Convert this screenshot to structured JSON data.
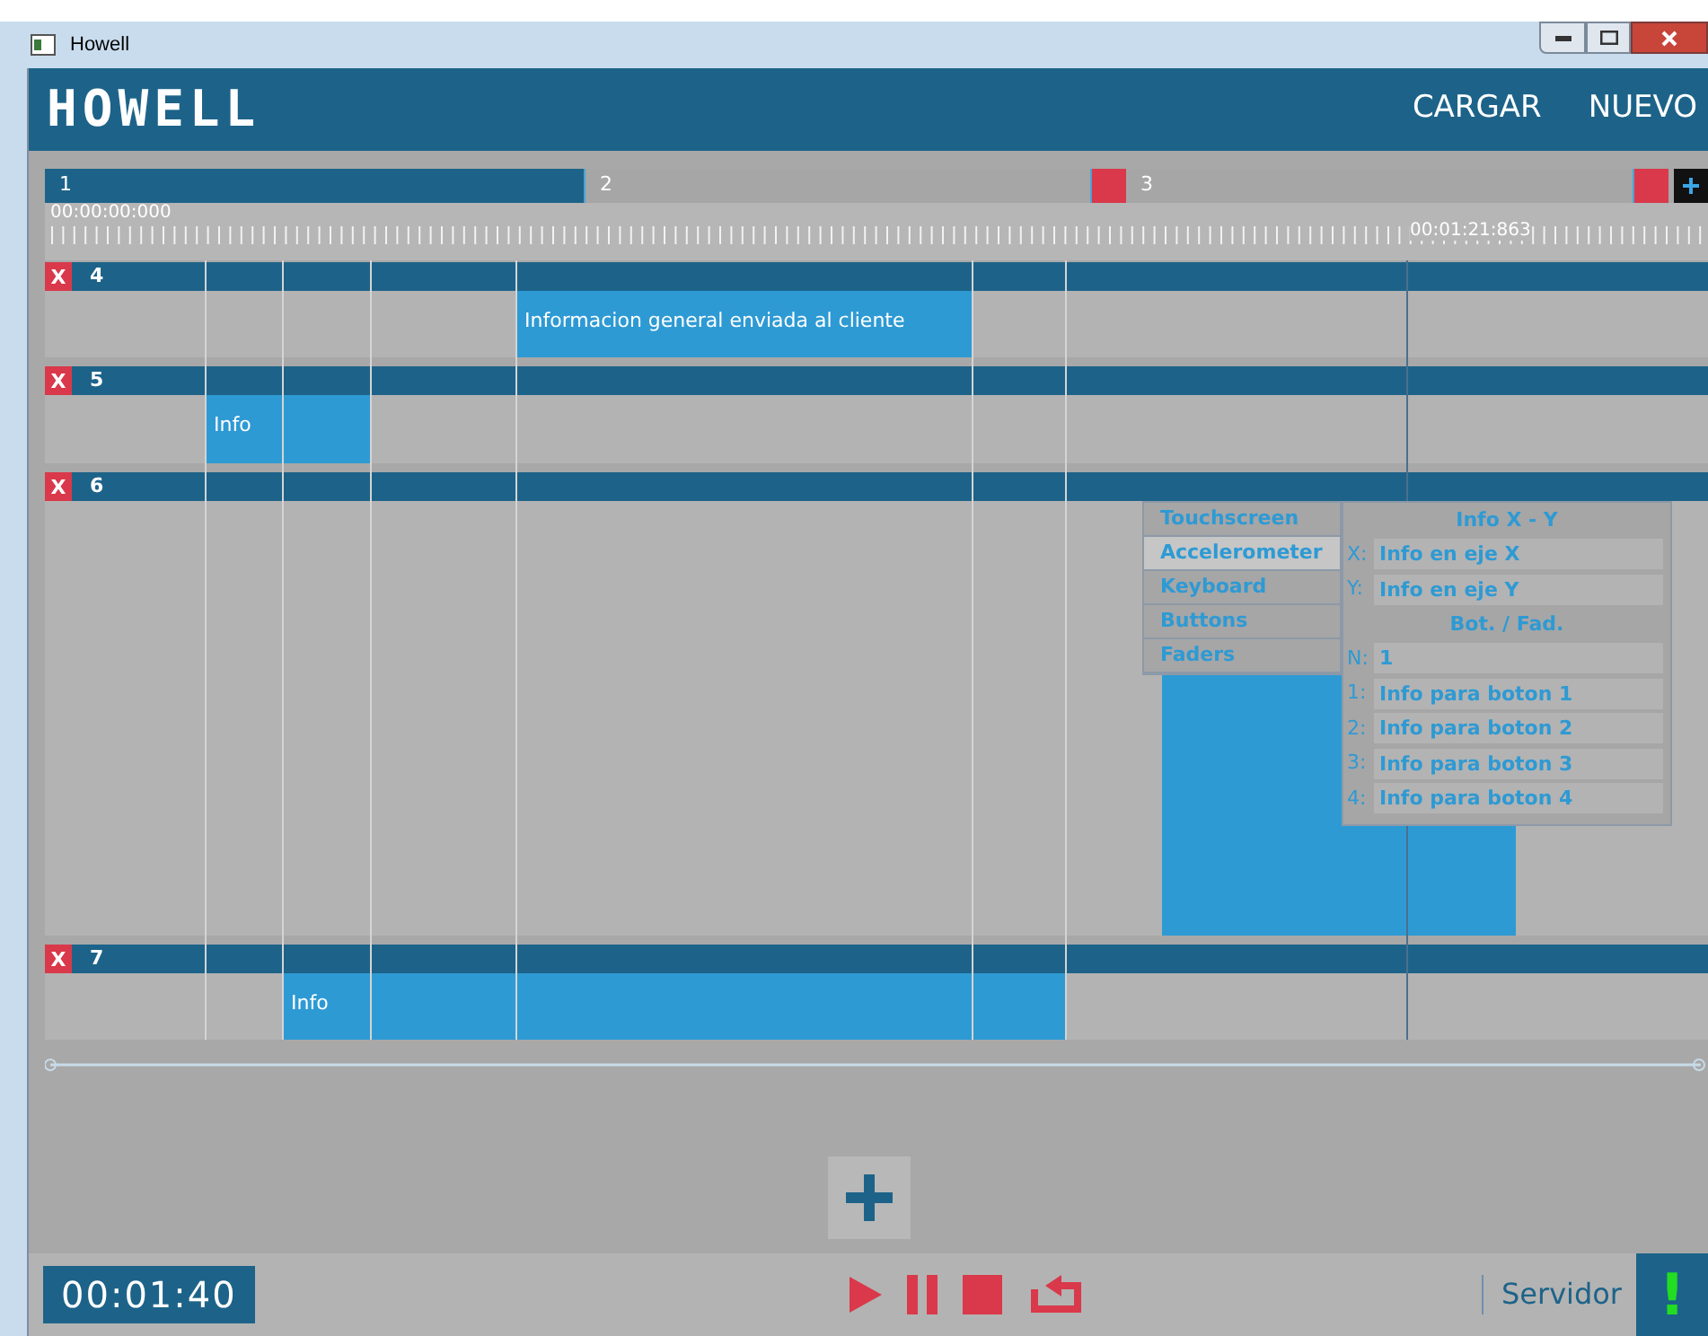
{
  "window": {
    "title": "Howell"
  },
  "header": {
    "logo": "HOWELL",
    "actions": [
      "CARGAR",
      "NUEVO"
    ]
  },
  "scenes": [
    {
      "label": "1",
      "selected": true
    },
    {
      "label": "2",
      "selected": false
    },
    {
      "label": "3",
      "selected": false
    }
  ],
  "ruler": {
    "start": "00:00:00:000",
    "playhead": "00:01:21:863"
  },
  "tracks": [
    {
      "delete": "X",
      "number": "4",
      "clips": [
        {
          "kind": "labeled",
          "text": "Informacion general enviada al cliente"
        }
      ]
    },
    {
      "delete": "X",
      "number": "5",
      "clips": [
        {
          "kind": "labeled",
          "text": "Info"
        }
      ]
    },
    {
      "delete": "X",
      "number": "6",
      "clips": [
        {
          "kind": "plain"
        }
      ]
    },
    {
      "delete": "X",
      "number": "7",
      "clips": [
        {
          "kind": "labeled",
          "text": "Info"
        }
      ]
    }
  ],
  "sensor_popup": {
    "menu": [
      {
        "label": "Touchscreen",
        "selected": false
      },
      {
        "label": "Accelerometer",
        "selected": true
      },
      {
        "label": "Keyboard",
        "selected": false
      },
      {
        "label": "Buttons",
        "selected": false
      },
      {
        "label": "Faders",
        "selected": false
      }
    ],
    "sections": [
      {
        "title": "Info X - Y",
        "fields": [
          {
            "label": "X:",
            "value": "Info en eje X"
          },
          {
            "label": "Y:",
            "value": "Info en eje Y"
          }
        ]
      },
      {
        "title": "Bot. / Fad.",
        "fields": [
          {
            "label": "N:",
            "value": "1"
          },
          {
            "label": "1:",
            "value": "Info para boton 1"
          },
          {
            "label": "2:",
            "value": "Info para boton 2"
          },
          {
            "label": "3:",
            "value": "Info para boton 3"
          },
          {
            "label": "4:",
            "value": "Info para boton 4"
          }
        ]
      }
    ]
  },
  "transport": {
    "time": "00:01:40"
  },
  "status": {
    "server": "Servidor",
    "indicator": "!"
  }
}
